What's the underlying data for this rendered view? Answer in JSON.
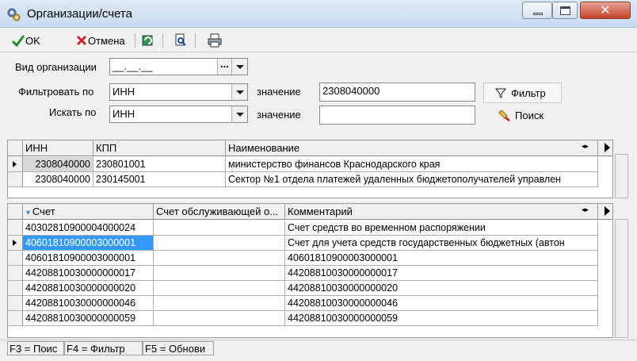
{
  "window": {
    "title": "Организации/счета",
    "close_glyph": "✕"
  },
  "toolbar": {
    "ok_label": "OK",
    "cancel_label": "Отмена",
    "icons": [
      "refresh-icon",
      "find-icon",
      "print-icon"
    ]
  },
  "form": {
    "org_type_label": "Вид организации",
    "org_type_value": "__.__.__",
    "org_type_btn": "...",
    "filter_by_label": "Фильтровать по",
    "filter_by_value": "ИНН",
    "filter_value_label": "значение",
    "filter_value": "2308040000",
    "search_by_label": "Искать по",
    "search_by_value": "ИНН",
    "search_value_label": "значение",
    "search_value": "",
    "filter_button": "Фильтр",
    "search_button": "Поиск"
  },
  "orgs_table": {
    "columns": [
      "ИНН",
      "КПП",
      "Наименование"
    ],
    "rows": [
      {
        "inn": "2308040000",
        "kpp": "230801001",
        "name": "министерство финансов Краснодарского края"
      },
      {
        "inn": "2308040000",
        "kpp": "230145001",
        "name": "Сектор №1 отдела платежей удаленных бюджетополучателей управлен"
      }
    ]
  },
  "accounts_table": {
    "columns": [
      "Счет",
      "Счет обслуживающей о...",
      "Комментарий"
    ],
    "rows": [
      {
        "account": "40302810900004000024",
        "service": "",
        "comment": "Счет средств во временном распоряжении"
      },
      {
        "account": "40601810900003000001",
        "service": "",
        "comment": "Счет для учета средств государственных бюджетных (автон"
      },
      {
        "account": "40601810900003000001",
        "service": "",
        "comment": "40601810900003000001"
      },
      {
        "account": "44208810030000000017",
        "service": "",
        "comment": "44208810030000000017"
      },
      {
        "account": "44208810030000000020",
        "service": "",
        "comment": "44208810030000000020"
      },
      {
        "account": "44208810030000000046",
        "service": "",
        "comment": "44208810030000000046"
      },
      {
        "account": "44208810030000000059",
        "service": "",
        "comment": "44208810030000000059"
      }
    ]
  },
  "statusbar": {
    "items": [
      "F3 = Поис",
      "F4 = Фильтр",
      "F5 = Обнови"
    ]
  },
  "colors": {
    "selection": "#3399ff",
    "titlebar": "#c9dcef",
    "close_button": "#c4422c"
  }
}
